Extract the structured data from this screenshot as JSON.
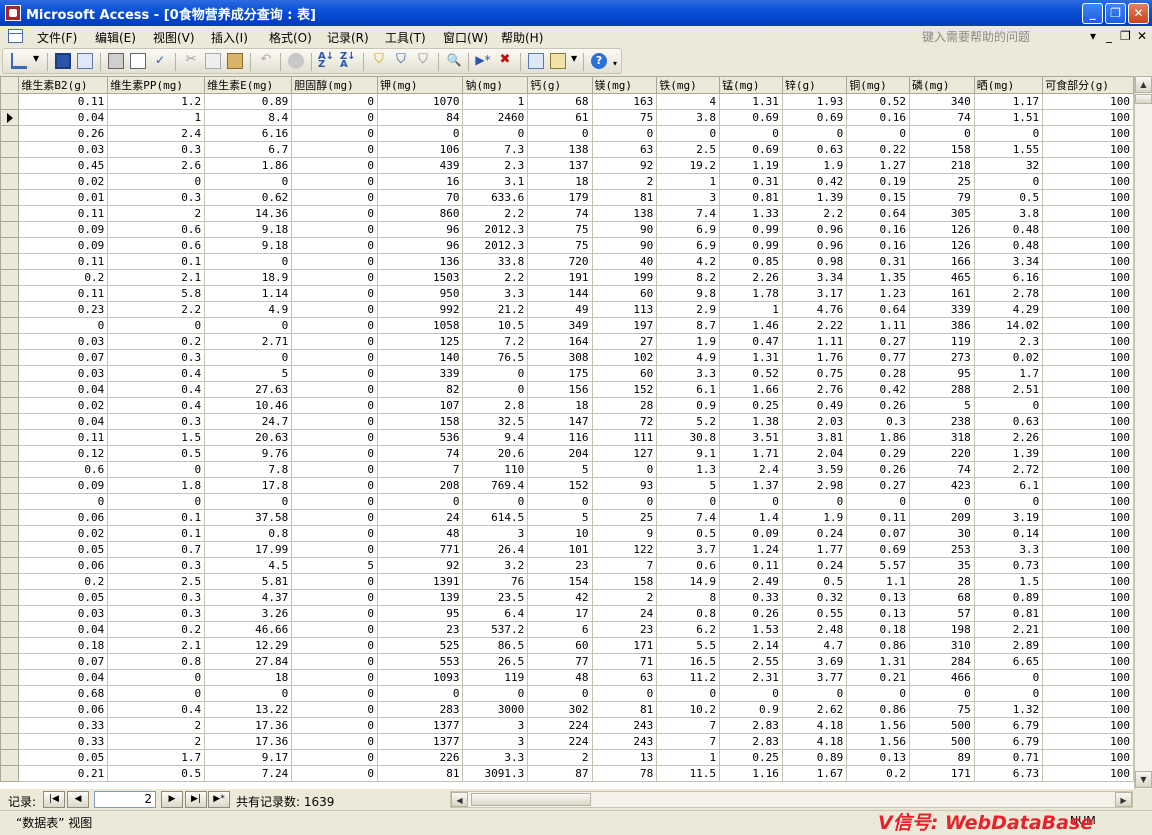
{
  "window": {
    "title": "Microsoft Access - [0食物营养成分查询 : 表]"
  },
  "menu": [
    "文件(F)",
    "编辑(E)",
    "视图(V)",
    "插入(I)",
    "格式(O)",
    "记录(R)",
    "工具(T)",
    "窗口(W)",
    "帮助(H)"
  ],
  "help_prompt": "键入需要帮助的问题",
  "columns": [
    "维生素B2(g)",
    "维生素PP(mg)",
    "维生素E(mg)",
    "胆固醇(mg)",
    "钾(mg)",
    "钠(mg)",
    "钙(g)",
    "镁(mg)",
    "铁(mg)",
    "锰(mg)",
    "锌(g)",
    "铜(mg)",
    "磷(mg)",
    "晒(mg)",
    "可食部分(g)"
  ],
  "current_row": 1,
  "rows": [
    [
      "0.11",
      "1.2",
      "0.89",
      "0",
      "1070",
      "1",
      "68",
      "163",
      "4",
      "1.31",
      "1.93",
      "0.52",
      "340",
      "1.17",
      "100"
    ],
    [
      "0.04",
      "1",
      "8.4",
      "0",
      "84",
      "2460",
      "61",
      "75",
      "3.8",
      "0.69",
      "0.69",
      "0.16",
      "74",
      "1.51",
      "100"
    ],
    [
      "0.26",
      "2.4",
      "6.16",
      "0",
      "0",
      "0",
      "0",
      "0",
      "0",
      "0",
      "0",
      "0",
      "0",
      "0",
      "100"
    ],
    [
      "0.03",
      "0.3",
      "6.7",
      "0",
      "106",
      "7.3",
      "138",
      "63",
      "2.5",
      "0.69",
      "0.63",
      "0.22",
      "158",
      "1.55",
      "100"
    ],
    [
      "0.45",
      "2.6",
      "1.86",
      "0",
      "439",
      "2.3",
      "137",
      "92",
      "19.2",
      "1.19",
      "1.9",
      "1.27",
      "218",
      "32",
      "100"
    ],
    [
      "0.02",
      "0",
      "0",
      "0",
      "16",
      "3.1",
      "18",
      "2",
      "1",
      "0.31",
      "0.42",
      "0.19",
      "25",
      "0",
      "100"
    ],
    [
      "0.01",
      "0.3",
      "0.62",
      "0",
      "70",
      "633.6",
      "179",
      "81",
      "3",
      "0.81",
      "1.39",
      "0.15",
      "79",
      "0.5",
      "100"
    ],
    [
      "0.11",
      "2",
      "14.36",
      "0",
      "860",
      "2.2",
      "74",
      "138",
      "7.4",
      "1.33",
      "2.2",
      "0.64",
      "305",
      "3.8",
      "100"
    ],
    [
      "0.09",
      "0.6",
      "9.18",
      "0",
      "96",
      "2012.3",
      "75",
      "90",
      "6.9",
      "0.99",
      "0.96",
      "0.16",
      "126",
      "0.48",
      "100"
    ],
    [
      "0.09",
      "0.6",
      "9.18",
      "0",
      "96",
      "2012.3",
      "75",
      "90",
      "6.9",
      "0.99",
      "0.96",
      "0.16",
      "126",
      "0.48",
      "100"
    ],
    [
      "0.11",
      "0.1",
      "0",
      "0",
      "136",
      "33.8",
      "720",
      "40",
      "4.2",
      "0.85",
      "0.98",
      "0.31",
      "166",
      "3.34",
      "100"
    ],
    [
      "0.2",
      "2.1",
      "18.9",
      "0",
      "1503",
      "2.2",
      "191",
      "199",
      "8.2",
      "2.26",
      "3.34",
      "1.35",
      "465",
      "6.16",
      "100"
    ],
    [
      "0.11",
      "5.8",
      "1.14",
      "0",
      "950",
      "3.3",
      "144",
      "60",
      "9.8",
      "1.78",
      "3.17",
      "1.23",
      "161",
      "2.78",
      "100"
    ],
    [
      "0.23",
      "2.2",
      "4.9",
      "0",
      "992",
      "21.2",
      "49",
      "113",
      "2.9",
      "1",
      "4.76",
      "0.64",
      "339",
      "4.29",
      "100"
    ],
    [
      "0",
      "0",
      "0",
      "0",
      "1058",
      "10.5",
      "349",
      "197",
      "8.7",
      "1.46",
      "2.22",
      "1.11",
      "386",
      "14.02",
      "100"
    ],
    [
      "0.03",
      "0.2",
      "2.71",
      "0",
      "125",
      "7.2",
      "164",
      "27",
      "1.9",
      "0.47",
      "1.11",
      "0.27",
      "119",
      "2.3",
      "100"
    ],
    [
      "0.07",
      "0.3",
      "0",
      "0",
      "140",
      "76.5",
      "308",
      "102",
      "4.9",
      "1.31",
      "1.76",
      "0.77",
      "273",
      "0.02",
      "100"
    ],
    [
      "0.03",
      "0.4",
      "5",
      "0",
      "339",
      "0",
      "175",
      "60",
      "3.3",
      "0.52",
      "0.75",
      "0.28",
      "95",
      "1.7",
      "100"
    ],
    [
      "0.04",
      "0.4",
      "27.63",
      "0",
      "82",
      "0",
      "156",
      "152",
      "6.1",
      "1.66",
      "2.76",
      "0.42",
      "288",
      "2.51",
      "100"
    ],
    [
      "0.02",
      "0.4",
      "10.46",
      "0",
      "107",
      "2.8",
      "18",
      "28",
      "0.9",
      "0.25",
      "0.49",
      "0.26",
      "5",
      "0",
      "100"
    ],
    [
      "0.04",
      "0.3",
      "24.7",
      "0",
      "158",
      "32.5",
      "147",
      "72",
      "5.2",
      "1.38",
      "2.03",
      "0.3",
      "238",
      "0.63",
      "100"
    ],
    [
      "0.11",
      "1.5",
      "20.63",
      "0",
      "536",
      "9.4",
      "116",
      "111",
      "30.8",
      "3.51",
      "3.81",
      "1.86",
      "318",
      "2.26",
      "100"
    ],
    [
      "0.12",
      "0.5",
      "9.76",
      "0",
      "74",
      "20.6",
      "204",
      "127",
      "9.1",
      "1.71",
      "2.04",
      "0.29",
      "220",
      "1.39",
      "100"
    ],
    [
      "0.6",
      "0",
      "7.8",
      "0",
      "7",
      "110",
      "5",
      "0",
      "1.3",
      "2.4",
      "3.59",
      "0.26",
      "74",
      "2.72",
      "100"
    ],
    [
      "0.09",
      "1.8",
      "17.8",
      "0",
      "208",
      "769.4",
      "152",
      "93",
      "5",
      "1.37",
      "2.98",
      "0.27",
      "423",
      "6.1",
      "100"
    ],
    [
      "0",
      "0",
      "0",
      "0",
      "0",
      "0",
      "0",
      "0",
      "0",
      "0",
      "0",
      "0",
      "0",
      "0",
      "100"
    ],
    [
      "0.06",
      "0.1",
      "37.58",
      "0",
      "24",
      "614.5",
      "5",
      "25",
      "7.4",
      "1.4",
      "1.9",
      "0.11",
      "209",
      "3.19",
      "100"
    ],
    [
      "0.02",
      "0.1",
      "0.8",
      "0",
      "48",
      "3",
      "10",
      "9",
      "0.5",
      "0.09",
      "0.24",
      "0.07",
      "30",
      "0.14",
      "100"
    ],
    [
      "0.05",
      "0.7",
      "17.99",
      "0",
      "771",
      "26.4",
      "101",
      "122",
      "3.7",
      "1.24",
      "1.77",
      "0.69",
      "253",
      "3.3",
      "100"
    ],
    [
      "0.06",
      "0.3",
      "4.5",
      "5",
      "92",
      "3.2",
      "23",
      "7",
      "0.6",
      "0.11",
      "0.24",
      "5.57",
      "35",
      "0.73",
      "100"
    ],
    [
      "0.2",
      "2.5",
      "5.81",
      "0",
      "1391",
      "76",
      "154",
      "158",
      "14.9",
      "2.49",
      "0.5",
      "1.1",
      "28",
      "1.5",
      "100"
    ],
    [
      "0.05",
      "0.3",
      "4.37",
      "0",
      "139",
      "23.5",
      "42",
      "2",
      "8",
      "0.33",
      "0.32",
      "0.13",
      "68",
      "0.89",
      "100"
    ],
    [
      "0.03",
      "0.3",
      "3.26",
      "0",
      "95",
      "6.4",
      "17",
      "24",
      "0.8",
      "0.26",
      "0.55",
      "0.13",
      "57",
      "0.81",
      "100"
    ],
    [
      "0.04",
      "0.2",
      "46.66",
      "0",
      "23",
      "537.2",
      "6",
      "23",
      "6.2",
      "1.53",
      "2.48",
      "0.18",
      "198",
      "2.21",
      "100"
    ],
    [
      "0.18",
      "2.1",
      "12.29",
      "0",
      "525",
      "86.5",
      "60",
      "171",
      "5.5",
      "2.14",
      "4.7",
      "0.86",
      "310",
      "2.89",
      "100"
    ],
    [
      "0.07",
      "0.8",
      "27.84",
      "0",
      "553",
      "26.5",
      "77",
      "71",
      "16.5",
      "2.55",
      "3.69",
      "1.31",
      "284",
      "6.65",
      "100"
    ],
    [
      "0.04",
      "0",
      "18",
      "0",
      "1093",
      "119",
      "48",
      "63",
      "11.2",
      "2.31",
      "3.77",
      "0.21",
      "466",
      "0",
      "100"
    ],
    [
      "0.68",
      "0",
      "0",
      "0",
      "0",
      "0",
      "0",
      "0",
      "0",
      "0",
      "0",
      "0",
      "0",
      "0",
      "100"
    ],
    [
      "0.06",
      "0.4",
      "13.22",
      "0",
      "283",
      "3000",
      "302",
      "81",
      "10.2",
      "0.9",
      "2.62",
      "0.86",
      "75",
      "1.32",
      "100"
    ],
    [
      "0.33",
      "2",
      "17.36",
      "0",
      "1377",
      "3",
      "224",
      "243",
      "7",
      "2.83",
      "4.18",
      "1.56",
      "500",
      "6.79",
      "100"
    ],
    [
      "0.33",
      "2",
      "17.36",
      "0",
      "1377",
      "3",
      "224",
      "243",
      "7",
      "2.83",
      "4.18",
      "1.56",
      "500",
      "6.79",
      "100"
    ],
    [
      "0.05",
      "1.7",
      "9.17",
      "0",
      "226",
      "3.3",
      "2",
      "13",
      "1",
      "0.25",
      "0.89",
      "0.13",
      "89",
      "0.71",
      "100"
    ],
    [
      "0.21",
      "0.5",
      "7.24",
      "0",
      "81",
      "3091.3",
      "87",
      "78",
      "11.5",
      "1.16",
      "1.67",
      "0.2",
      "171",
      "6.73",
      "100"
    ]
  ],
  "navigator": {
    "label": "记录:",
    "current": "2",
    "total_label": "共有记录数: 1639"
  },
  "status": {
    "view": "“数据表” 视图",
    "right": "NUM"
  },
  "watermark": "V信号: WebDataBase"
}
